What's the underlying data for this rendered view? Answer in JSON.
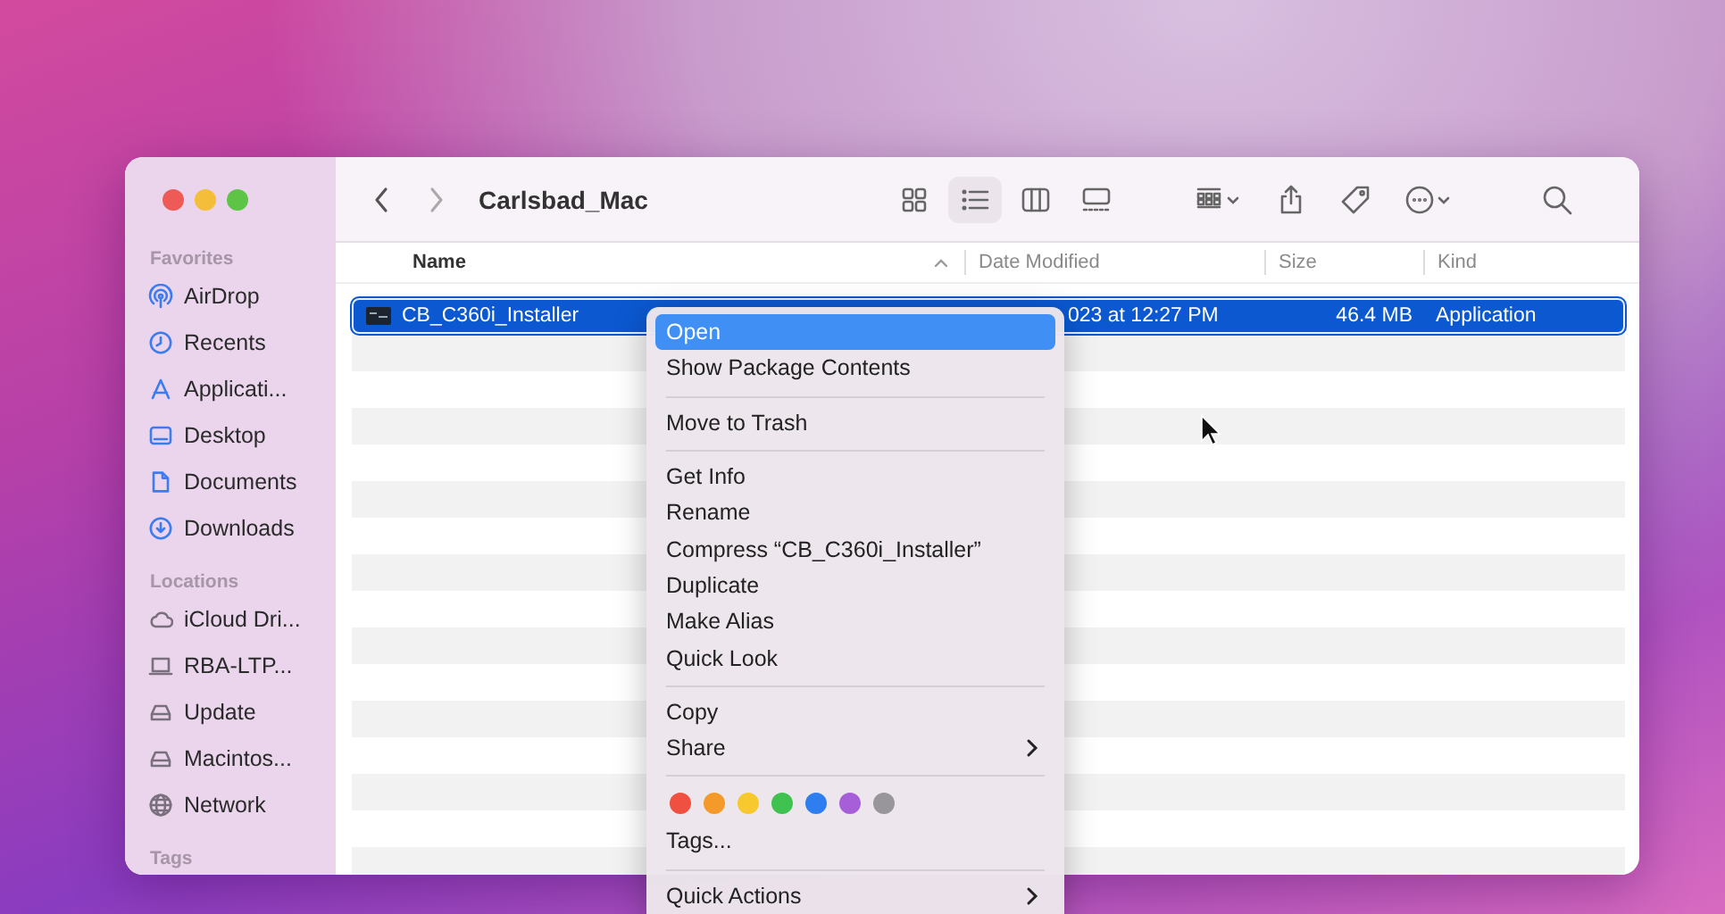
{
  "window": {
    "title": "Carlsbad_Mac"
  },
  "sidebar": {
    "sections": [
      {
        "heading": "Favorites",
        "items": [
          {
            "label": "AirDrop",
            "kind": "airdrop"
          },
          {
            "label": "Recents",
            "kind": "clock"
          },
          {
            "label": "Applicati...",
            "kind": "apps"
          },
          {
            "label": "Desktop",
            "kind": "desktop"
          },
          {
            "label": "Documents",
            "kind": "document"
          },
          {
            "label": "Downloads",
            "kind": "download"
          }
        ]
      },
      {
        "heading": "Locations",
        "items": [
          {
            "label": "iCloud Dri...",
            "kind": "cloud"
          },
          {
            "label": "RBA-LTP...",
            "kind": "laptop"
          },
          {
            "label": "Update",
            "kind": "drive"
          },
          {
            "label": "Macintos...",
            "kind": "drive"
          },
          {
            "label": "Network",
            "kind": "globe"
          }
        ]
      },
      {
        "heading": "Tags"
      }
    ]
  },
  "toolbar": {
    "view_buttons": [
      {
        "kind": "icons",
        "selected": false
      },
      {
        "kind": "list",
        "selected": true
      },
      {
        "kind": "columns",
        "selected": false
      },
      {
        "kind": "gallery",
        "selected": false
      }
    ],
    "tools": [
      {
        "kind": "group"
      },
      {
        "kind": "share"
      },
      {
        "kind": "tag"
      },
      {
        "kind": "more"
      },
      {
        "kind": "search"
      }
    ]
  },
  "table": {
    "columns": [
      {
        "label": "Name",
        "sorted": true
      },
      {
        "label": "Date Modified",
        "sorted": false
      },
      {
        "label": "Size",
        "sorted": false
      },
      {
        "label": "Kind",
        "sorted": false
      }
    ],
    "rows": [
      {
        "name": "CB_C360i_Installer",
        "date": "023 at 12:27 PM",
        "size": "46.4 MB",
        "kind": "Application",
        "selected": true
      }
    ]
  },
  "context_menu": {
    "items": [
      {
        "kind": "item",
        "label": "Open",
        "selected": true
      },
      {
        "kind": "item",
        "label": "Show Package Contents",
        "selected": false
      },
      {
        "kind": "separator"
      },
      {
        "kind": "item",
        "label": "Move to Trash",
        "selected": false
      },
      {
        "kind": "separator"
      },
      {
        "kind": "item",
        "label": "Get Info",
        "selected": false
      },
      {
        "kind": "item",
        "label": "Rename",
        "selected": false
      },
      {
        "kind": "item",
        "label": "Compress “CB_C360i_Installer”",
        "selected": false
      },
      {
        "kind": "item",
        "label": "Duplicate",
        "selected": false
      },
      {
        "kind": "item",
        "label": "Make Alias",
        "selected": false
      },
      {
        "kind": "item",
        "label": "Quick Look",
        "selected": false
      },
      {
        "kind": "separator"
      },
      {
        "kind": "item",
        "label": "Copy",
        "selected": false
      },
      {
        "kind": "submenu",
        "label": "Share",
        "selected": false
      },
      {
        "kind": "separator"
      },
      {
        "kind": "tags",
        "tags": [
          {
            "color": "#f0503f"
          },
          {
            "color": "#f39a2b"
          },
          {
            "color": "#f7c92e"
          },
          {
            "color": "#3fc250"
          },
          {
            "color": "#2f7ef0"
          },
          {
            "color": "#a65fd8"
          },
          {
            "color": "#98969a"
          }
        ]
      },
      {
        "kind": "item",
        "label": "Tags...",
        "selected": false
      },
      {
        "kind": "separator"
      },
      {
        "kind": "submenu",
        "label": "Quick Actions",
        "selected": false
      }
    ]
  }
}
